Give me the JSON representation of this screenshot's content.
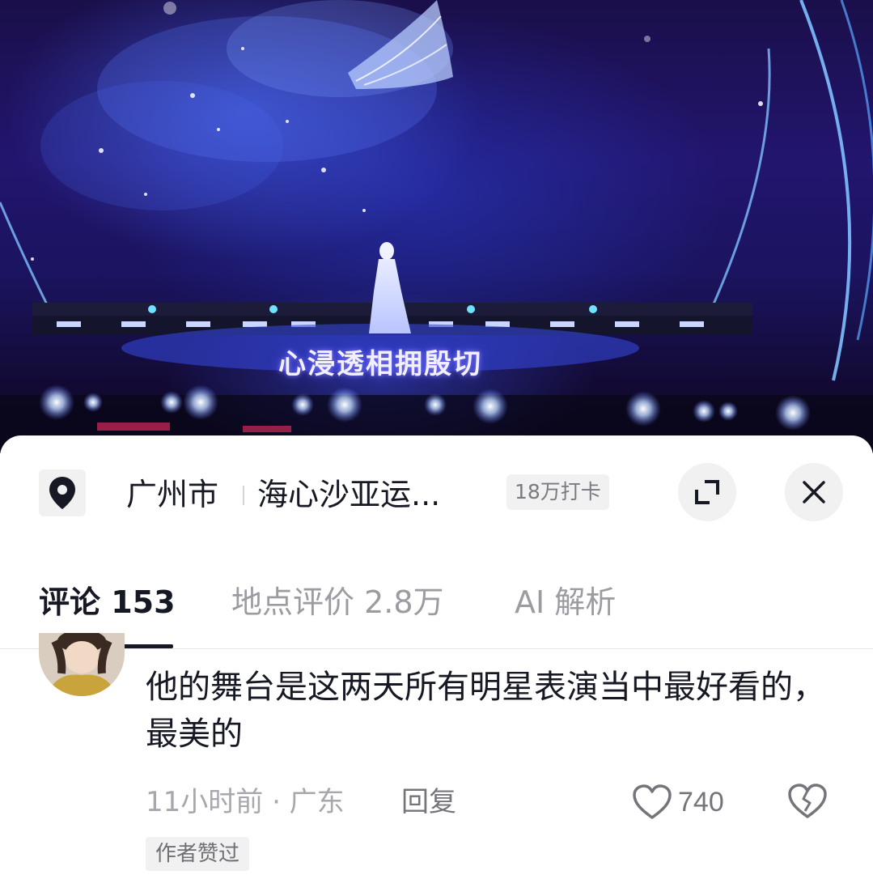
{
  "video": {
    "lyric": "心浸透相拥殷切"
  },
  "location": {
    "icon": "location-pin-icon",
    "city": "广州市",
    "venue": "海心沙亚运...",
    "checkins": "18万打卡",
    "expand_icon": "expand-icon",
    "close_icon": "close-icon"
  },
  "tabs": [
    {
      "label": "评论 153",
      "active": true
    },
    {
      "label": "地点评价 2.8万",
      "active": false
    },
    {
      "label": "AI 解析",
      "active": false
    }
  ],
  "comment": {
    "text": "他的舞台是这两天所有明星表演当中最好看的，最美的",
    "time_location": "11小时前 · 广东",
    "reply_label": "回复",
    "like_count": "740",
    "like_icon": "heart-icon",
    "dislike_icon": "broken-heart-icon",
    "author_badge": "作者赞过"
  },
  "colors": {
    "text_primary": "#161823",
    "text_secondary": "#9b9ba1",
    "stage_blue": "#2a2aa8"
  }
}
